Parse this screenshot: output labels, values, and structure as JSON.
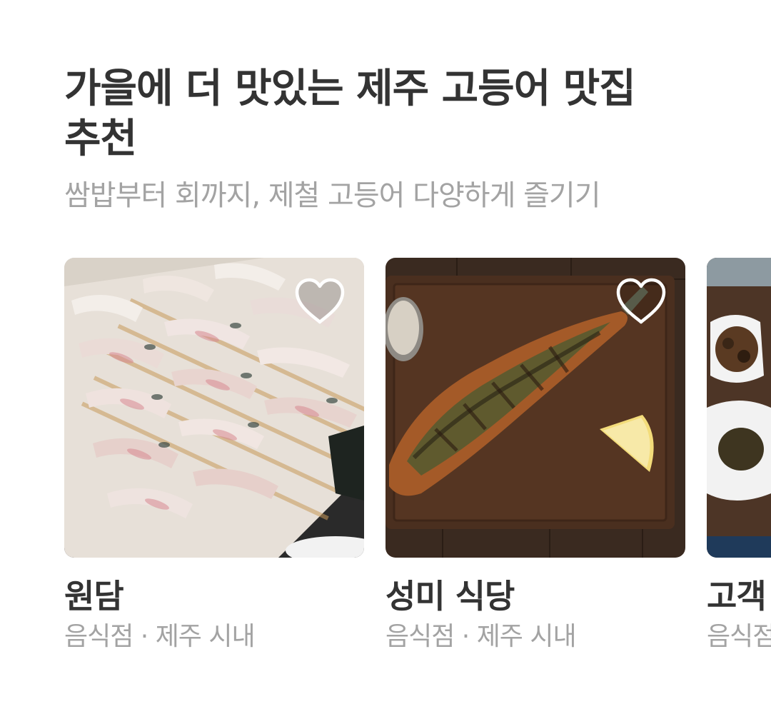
{
  "section": {
    "title": "가을에 더 맛있는 제주 고등어 맛집 추천",
    "subtitle": "쌈밥부터 회까지, 제철 고등어 다양하게 즐기기"
  },
  "cards": [
    {
      "name": "원담",
      "category": "음식점 · 제주 시내",
      "image_icon": "mackerel-sashimi-photo",
      "heart_icon": "heart-outline-icon"
    },
    {
      "name": "성미 식당",
      "category": "음식점 · 제주 시내",
      "image_icon": "grilled-mackerel-photo",
      "heart_icon": "heart-outline-icon"
    },
    {
      "name": "고객",
      "category": "음식점",
      "image_icon": "side-dishes-photo",
      "heart_icon": "heart-outline-icon"
    }
  ],
  "colors": {
    "title": "#333333",
    "secondary_text": "#a3a3a3",
    "background": "#ffffff"
  }
}
